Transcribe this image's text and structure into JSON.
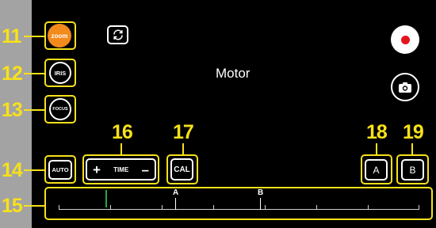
{
  "controls": {
    "zoom_label": "zoom",
    "iris_label": "IRIS",
    "focus_label": "FOCUS",
    "auto_label": "AUTO",
    "time_plus": "+",
    "time_label": "TIME",
    "time_minus": "–",
    "cal_label": "CAL",
    "a_label": "A",
    "b_label": "B"
  },
  "title": "Motor",
  "timeline": {
    "marker_a_label": "A",
    "marker_b_label": "B"
  },
  "callouts": [
    "11",
    "12",
    "13",
    "14",
    "15",
    "16",
    "17",
    "18",
    "19"
  ],
  "colors": {
    "accent": "#f7e11a",
    "zoom_active": "#f28a1c",
    "record": "#e3141b",
    "playhead": "#2aa63d"
  },
  "icons": {
    "sync": "sync-icon",
    "record": "record-icon",
    "camera": "camera-icon"
  }
}
